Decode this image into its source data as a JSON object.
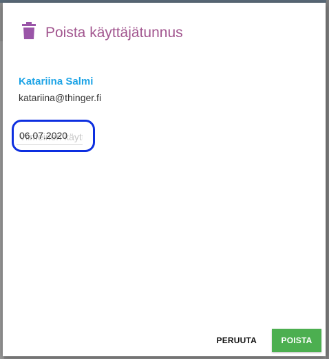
{
  "dialog": {
    "title": "Poista käyttäjätunnus",
    "title_color": "#a2568f",
    "icon": "trash-icon"
  },
  "user": {
    "name": "Katariina Salmi",
    "email": "katariina@thinger.fi"
  },
  "date_field": {
    "value": "06.07.2020",
    "placeholder": "Viimeinen käyttöpäiv"
  },
  "actions": {
    "cancel_label": "PERUUTA",
    "delete_label": "POISTA",
    "delete_color": "#4caf50"
  },
  "colors": {
    "name_accent": "#1ea4e6",
    "focus_ring": "#0d2fe0"
  }
}
